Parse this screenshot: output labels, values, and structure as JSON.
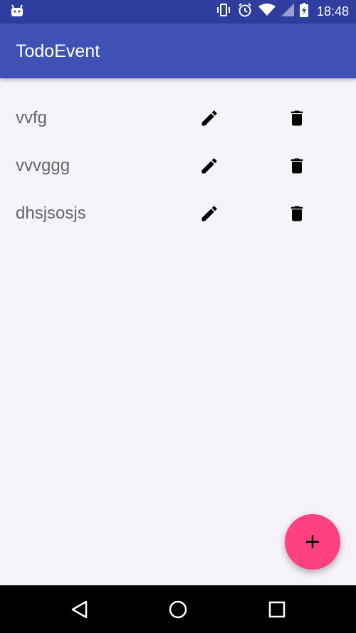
{
  "status_bar": {
    "time": "18:48",
    "icons": [
      "android-notification-icon",
      "vibrate-icon",
      "alarm-icon",
      "wifi-icon",
      "signal-icon",
      "battery-charging-icon"
    ]
  },
  "app_bar": {
    "title": "TodoEvent"
  },
  "todos": [
    {
      "text": "vvfg"
    },
    {
      "text": "vvvggg"
    },
    {
      "text": "dhsjsosjs"
    }
  ],
  "icons": {
    "edit": "pencil-icon",
    "delete": "trash-icon",
    "fab": "plus-icon"
  },
  "colors": {
    "status_bar": "#2f3e9e",
    "app_bar": "#3f51b5",
    "fab": "#ff4081",
    "background": "#f6f4f9",
    "nav_bar": "#000000"
  },
  "nav_bar": {
    "buttons": [
      "back-icon",
      "home-icon",
      "recents-icon"
    ]
  }
}
